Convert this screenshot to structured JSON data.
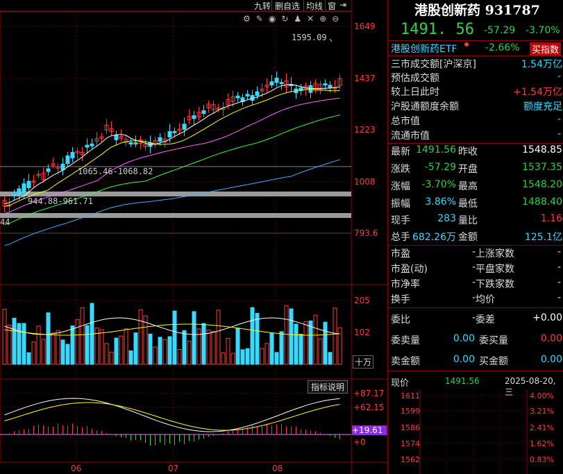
{
  "toolbar": {
    "btn_jiuzhuan": "九转",
    "btn_self": "删自选",
    "btn_junxian": "均线",
    "btn_window": "窗"
  },
  "price_axis": {
    "p1": "1649",
    "p2": "1437",
    "p3": "1223",
    "p4": "1008",
    "p5": "793.6"
  },
  "price_annotations": {
    "high_label": "1595.09",
    "zone1": "1065.46-1068.82",
    "zone2": "944.88-961.71",
    "low_label": "44"
  },
  "volume_axis": {
    "v1": "205",
    "v2": "102",
    "unit": "十万"
  },
  "indicator": {
    "button": "指标说明",
    "v1": "+87.17",
    "v2": "+62.15",
    "v3": "+19.61",
    "v4": "+0"
  },
  "months": {
    "m1": "06",
    "m2": "07",
    "m3": "08"
  },
  "header": {
    "title": "港股创新药 931787",
    "price": "1491. 56",
    "change": "-57.29",
    "pct": "-3.70%"
  },
  "etf": {
    "name": "港股创新药ETF",
    "pct": "-2.66%",
    "buy": "买指数"
  },
  "market": {
    "l1": "三市成交额[沪深京]",
    "v1": "1.54万亿",
    "l2": "预估成交额",
    "v2": "-",
    "l3": "较上日此时",
    "v3": "+1.54万亿",
    "l4": "沪股通额度余额",
    "v4": "额度充足",
    "l5": "总市值",
    "v5": "-",
    "l6": "流通市值",
    "v6": "-"
  },
  "quote": {
    "zuixin_l": "最新",
    "zuixin_v": "1491.56",
    "zuoshou_l": "昨收",
    "zuoshou_v": "1548.85",
    "zhangdie_l": "涨跌",
    "zhangdie_v": "-57.29",
    "kaipan_l": "开盘",
    "kaipan_v": "1537.35",
    "zhangfu_l": "涨幅",
    "zhangfu_v": "-3.70%",
    "zuigao_l": "最高",
    "zuigao_v": "1548.20",
    "zhenfu_l": "振幅",
    "zhenfu_v": "3.86%",
    "zuidi_l": "最低",
    "zuidi_v": "1488.40",
    "xianshou_l": "现手",
    "xianshou_v": "283",
    "liangbi_l": "量比",
    "liangbi_v": "1.16",
    "zongshou_l": "总手",
    "zongshou_v": "682.26万",
    "jine_l": "金额",
    "jine_v": "125.1亿"
  },
  "valuation": {
    "pe_l": "市盈",
    "pe_v": "-",
    "up_l": "上涨家数",
    "up_v": "-",
    "ped_l": "市盈(动)",
    "ped_v": "-",
    "flat_l": "平盘家数",
    "flat_v": "-",
    "pb_l": "市净率",
    "pb_v": "-",
    "down_l": "下跌家数",
    "down_v": "-",
    "turn_l": "换手",
    "turn_v": "-",
    "avg_l": "均价",
    "avg_v": "-"
  },
  "orders": {
    "wb_l": "委比",
    "wb_v": "-",
    "wc_l": "委差",
    "wc_v": "+0.00",
    "ws_l": "委卖量",
    "ws_v": "0.00",
    "wbv_l": "委买量",
    "wbv_v": "0.00",
    "sa_l": "卖金额",
    "sa_v": "0.00",
    "ba_l": "买金额",
    "ba_v": "0.00"
  },
  "intraday": {
    "xj_l": "现价",
    "xj_v": "1491.56",
    "date": "2025-08-20,三",
    "p1": "1611",
    "p2": "1599",
    "p3": "1586",
    "p4": "1574",
    "p5": "1562",
    "r1": "4.00%",
    "r2": "3.21%",
    "r3": "2.41%",
    "r4": "1.62%",
    "r5": "0.83%"
  },
  "colors": {
    "up": "#ff3b3b",
    "down": "#3ad7ff",
    "grid": "#8b0000",
    "ma5": "#ffffff",
    "ma10": "#ffff00",
    "ma20": "#ff66ff",
    "ma30": "#33ff33",
    "ma60": "#3ab0ff"
  }
}
